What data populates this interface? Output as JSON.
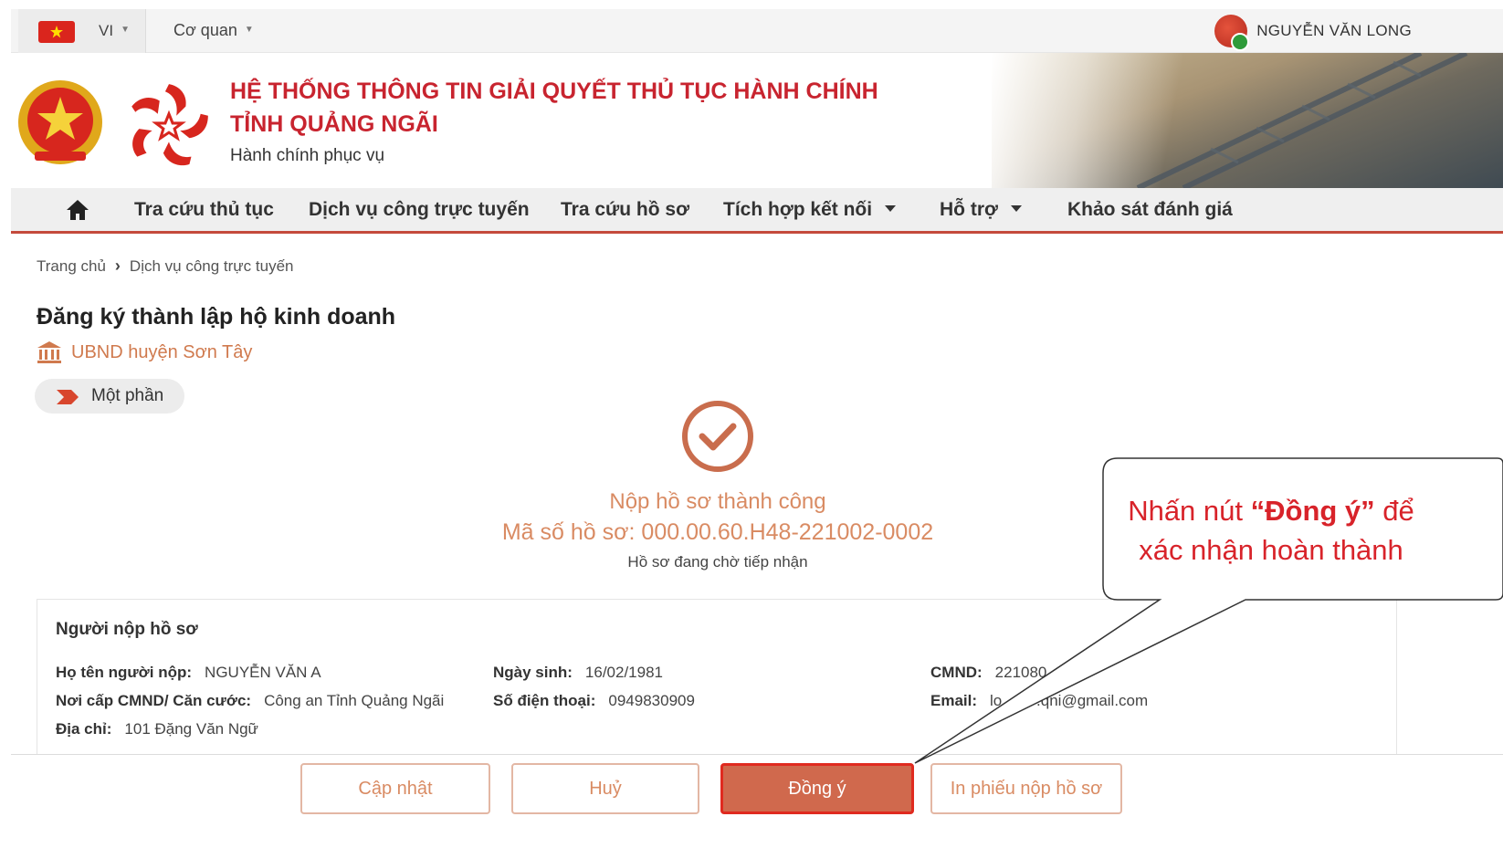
{
  "topbar": {
    "language": "VI",
    "agency_menu": "Cơ quan",
    "user_name": "NGUYỄN VĂN LONG"
  },
  "header": {
    "title_line1": "HỆ THỐNG THÔNG TIN GIẢI QUYẾT THỦ TỤC HÀNH CHÍNH",
    "title_line2": "TỈNH QUẢNG NGÃI",
    "slogan": "Hành chính phục vụ"
  },
  "nav": {
    "items": [
      {
        "label": "Tra cứu thủ tục"
      },
      {
        "label": "Dịch vụ công trực tuyến"
      },
      {
        "label": "Tra cứu hồ sơ"
      },
      {
        "label": "Tích hợp kết nối"
      },
      {
        "label": "Hỗ trợ"
      },
      {
        "label": "Khảo sát đánh giá"
      }
    ]
  },
  "breadcrumb": {
    "home": "Trang chủ",
    "current": "Dịch vụ công trực tuyến"
  },
  "page": {
    "title": "Đăng ký thành lập hộ kinh doanh",
    "agency": "UBND huyện Sơn Tây",
    "service_level": "Một phần"
  },
  "result": {
    "title": "Nộp hồ sơ thành công",
    "code": "Mã số hồ sơ: 000.00.60.H48-221002-0002",
    "status": "Hồ sơ đang chờ tiếp nhận"
  },
  "applicant": {
    "section_title": "Người nộp hồ sơ",
    "name_label": "Họ tên người nộp:",
    "name": "NGUYỄN VĂN A",
    "dob_label": "Ngày sinh:",
    "dob": "16/02/1981",
    "id_label": "CMND:",
    "id": "221080",
    "issued_label": "Nơi cấp CMND/ Căn cước:",
    "issued": "Công an Tỉnh Quảng Ngãi",
    "phone_label": "Số điện thoại:",
    "phone": "0949830909",
    "email_label": "Email:",
    "email": "lo        .qni@gmail.com",
    "address_label": "Địa chỉ:",
    "address": "101 Đặng Văn Ngữ"
  },
  "actions": {
    "update": "Cập nhật",
    "cancel": "Huỷ",
    "agree": "Đồng ý",
    "print": "In phiếu nộp hồ sơ"
  },
  "callout": {
    "prefix": "Nhấn nút ",
    "highlight": "“Đồng ý”",
    "suffix": " để xác nhận hoàn thành"
  },
  "colors": {
    "brand_red": "#c8242f",
    "accent_orange": "#d98b63",
    "primary_button": "#d0694d",
    "callout_red": "#d8232a"
  }
}
